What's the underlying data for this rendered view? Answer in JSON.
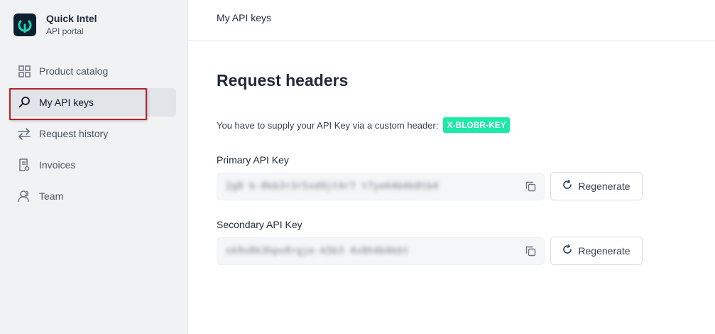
{
  "brand": {
    "name": "Quick Intel",
    "subtitle": "API portal"
  },
  "sidebar": {
    "items": [
      {
        "label": "Product catalog",
        "icon": "grid-icon",
        "active": false
      },
      {
        "label": "My API keys",
        "icon": "key-icon",
        "active": true
      },
      {
        "label": "Request history",
        "icon": "arrows-icon",
        "active": false
      },
      {
        "label": "Invoices",
        "icon": "invoice-icon",
        "active": false
      },
      {
        "label": "Team",
        "icon": "team-icon",
        "active": false
      }
    ]
  },
  "header": {
    "title": "My API keys"
  },
  "main": {
    "heading": "Request headers",
    "info_text": "You have to supply your API Key via a custom header:",
    "header_name": "X-BLOBR-KEY",
    "primary": {
      "label": "Primary API Key",
      "value": "2g8 b-8kb3r3r5xd9jt4r7 t7ye64b4k8tb4",
      "regenerate_label": "Regenerate"
    },
    "secondary": {
      "label": "Secondary API Key",
      "value": "sk9v8k3hpv8rgje-k5b3 4v8h4b4kbt",
      "regenerate_label": "Regenerate"
    }
  },
  "colors": {
    "accent_badge": "#1de9a8",
    "sidebar_bg": "#f1f2f4",
    "highlight_border": "#b3252a"
  }
}
